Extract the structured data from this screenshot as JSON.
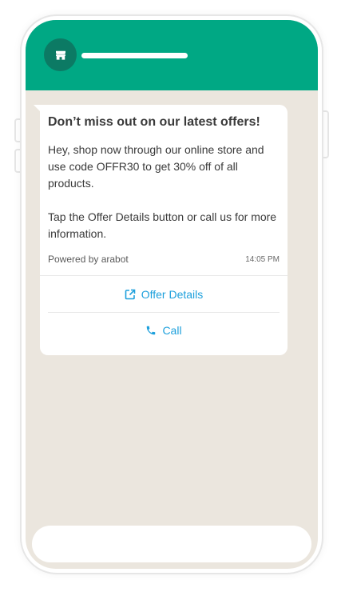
{
  "chat": {
    "header": {
      "avatar_icon": "store-icon",
      "accent_color": "#00a884"
    },
    "message": {
      "title": "Don’t miss out on our latest offers!",
      "body": "Hey, shop now through our online store and use code OFFR30 to get 30% off of all products.\n\nTap the Offer Details button or call us for more information.",
      "footer": "Powered by arabot",
      "time": "14:05 PM",
      "actions": [
        {
          "label": "Offer Details",
          "icon": "external-link-icon"
        },
        {
          "label": "Call",
          "icon": "phone-icon"
        }
      ]
    },
    "composer": {
      "placeholder": ""
    },
    "colors": {
      "background": "#ebe6de",
      "link": "#1ea0dc"
    }
  }
}
